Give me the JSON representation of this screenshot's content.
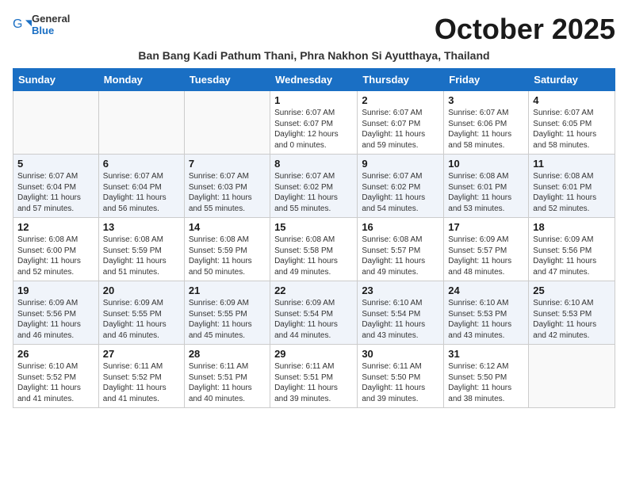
{
  "header": {
    "logo_general": "General",
    "logo_blue": "Blue",
    "month_title": "October 2025",
    "location": "Ban Bang Kadi Pathum Thani, Phra Nakhon Si Ayutthaya, Thailand"
  },
  "weekdays": [
    "Sunday",
    "Monday",
    "Tuesday",
    "Wednesday",
    "Thursday",
    "Friday",
    "Saturday"
  ],
  "weeks": [
    [
      {
        "day": "",
        "info": ""
      },
      {
        "day": "",
        "info": ""
      },
      {
        "day": "",
        "info": ""
      },
      {
        "day": "1",
        "info": "Sunrise: 6:07 AM\nSunset: 6:07 PM\nDaylight: 12 hours\nand 0 minutes."
      },
      {
        "day": "2",
        "info": "Sunrise: 6:07 AM\nSunset: 6:07 PM\nDaylight: 11 hours\nand 59 minutes."
      },
      {
        "day": "3",
        "info": "Sunrise: 6:07 AM\nSunset: 6:06 PM\nDaylight: 11 hours\nand 58 minutes."
      },
      {
        "day": "4",
        "info": "Sunrise: 6:07 AM\nSunset: 6:05 PM\nDaylight: 11 hours\nand 58 minutes."
      }
    ],
    [
      {
        "day": "5",
        "info": "Sunrise: 6:07 AM\nSunset: 6:04 PM\nDaylight: 11 hours\nand 57 minutes."
      },
      {
        "day": "6",
        "info": "Sunrise: 6:07 AM\nSunset: 6:04 PM\nDaylight: 11 hours\nand 56 minutes."
      },
      {
        "day": "7",
        "info": "Sunrise: 6:07 AM\nSunset: 6:03 PM\nDaylight: 11 hours\nand 55 minutes."
      },
      {
        "day": "8",
        "info": "Sunrise: 6:07 AM\nSunset: 6:02 PM\nDaylight: 11 hours\nand 55 minutes."
      },
      {
        "day": "9",
        "info": "Sunrise: 6:07 AM\nSunset: 6:02 PM\nDaylight: 11 hours\nand 54 minutes."
      },
      {
        "day": "10",
        "info": "Sunrise: 6:08 AM\nSunset: 6:01 PM\nDaylight: 11 hours\nand 53 minutes."
      },
      {
        "day": "11",
        "info": "Sunrise: 6:08 AM\nSunset: 6:01 PM\nDaylight: 11 hours\nand 52 minutes."
      }
    ],
    [
      {
        "day": "12",
        "info": "Sunrise: 6:08 AM\nSunset: 6:00 PM\nDaylight: 11 hours\nand 52 minutes."
      },
      {
        "day": "13",
        "info": "Sunrise: 6:08 AM\nSunset: 5:59 PM\nDaylight: 11 hours\nand 51 minutes."
      },
      {
        "day": "14",
        "info": "Sunrise: 6:08 AM\nSunset: 5:59 PM\nDaylight: 11 hours\nand 50 minutes."
      },
      {
        "day": "15",
        "info": "Sunrise: 6:08 AM\nSunset: 5:58 PM\nDaylight: 11 hours\nand 49 minutes."
      },
      {
        "day": "16",
        "info": "Sunrise: 6:08 AM\nSunset: 5:57 PM\nDaylight: 11 hours\nand 49 minutes."
      },
      {
        "day": "17",
        "info": "Sunrise: 6:09 AM\nSunset: 5:57 PM\nDaylight: 11 hours\nand 48 minutes."
      },
      {
        "day": "18",
        "info": "Sunrise: 6:09 AM\nSunset: 5:56 PM\nDaylight: 11 hours\nand 47 minutes."
      }
    ],
    [
      {
        "day": "19",
        "info": "Sunrise: 6:09 AM\nSunset: 5:56 PM\nDaylight: 11 hours\nand 46 minutes."
      },
      {
        "day": "20",
        "info": "Sunrise: 6:09 AM\nSunset: 5:55 PM\nDaylight: 11 hours\nand 46 minutes."
      },
      {
        "day": "21",
        "info": "Sunrise: 6:09 AM\nSunset: 5:55 PM\nDaylight: 11 hours\nand 45 minutes."
      },
      {
        "day": "22",
        "info": "Sunrise: 6:09 AM\nSunset: 5:54 PM\nDaylight: 11 hours\nand 44 minutes."
      },
      {
        "day": "23",
        "info": "Sunrise: 6:10 AM\nSunset: 5:54 PM\nDaylight: 11 hours\nand 43 minutes."
      },
      {
        "day": "24",
        "info": "Sunrise: 6:10 AM\nSunset: 5:53 PM\nDaylight: 11 hours\nand 43 minutes."
      },
      {
        "day": "25",
        "info": "Sunrise: 6:10 AM\nSunset: 5:53 PM\nDaylight: 11 hours\nand 42 minutes."
      }
    ],
    [
      {
        "day": "26",
        "info": "Sunrise: 6:10 AM\nSunset: 5:52 PM\nDaylight: 11 hours\nand 41 minutes."
      },
      {
        "day": "27",
        "info": "Sunrise: 6:11 AM\nSunset: 5:52 PM\nDaylight: 11 hours\nand 41 minutes."
      },
      {
        "day": "28",
        "info": "Sunrise: 6:11 AM\nSunset: 5:51 PM\nDaylight: 11 hours\nand 40 minutes."
      },
      {
        "day": "29",
        "info": "Sunrise: 6:11 AM\nSunset: 5:51 PM\nDaylight: 11 hours\nand 39 minutes."
      },
      {
        "day": "30",
        "info": "Sunrise: 6:11 AM\nSunset: 5:50 PM\nDaylight: 11 hours\nand 39 minutes."
      },
      {
        "day": "31",
        "info": "Sunrise: 6:12 AM\nSunset: 5:50 PM\nDaylight: 11 hours\nand 38 minutes."
      },
      {
        "day": "",
        "info": ""
      }
    ]
  ]
}
